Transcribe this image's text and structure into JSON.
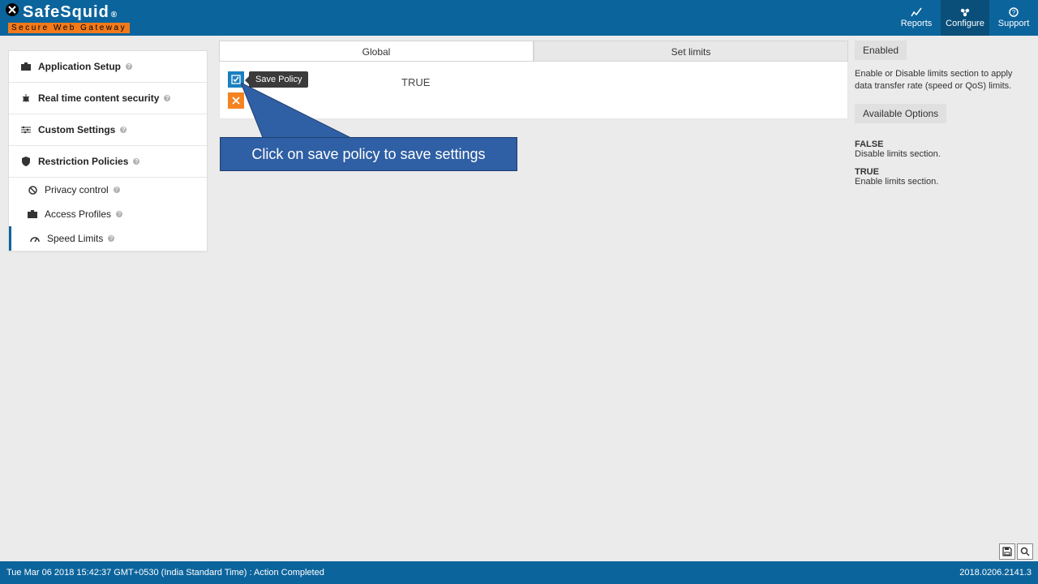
{
  "brand": {
    "name": "SafeSquid",
    "reg": "®",
    "tagline": "Secure Web Gateway"
  },
  "topnav": {
    "reports": "Reports",
    "configure": "Configure",
    "support": "Support"
  },
  "sidebar": {
    "items": [
      {
        "label": "Application Setup"
      },
      {
        "label": "Real time content security"
      },
      {
        "label": "Custom Settings"
      },
      {
        "label": "Restriction Policies"
      }
    ],
    "subitems": [
      {
        "label": "Privacy control"
      },
      {
        "label": "Access Profiles"
      },
      {
        "label": "Speed Limits"
      }
    ]
  },
  "tabs": {
    "global": "Global",
    "setlimits": "Set limits"
  },
  "content": {
    "save_tooltip": "Save Policy",
    "value": "TRUE"
  },
  "callout": {
    "text": "Click on save policy to save settings"
  },
  "rightpanel": {
    "label": "Enabled",
    "desc": "Enable or Disable limits section to apply data transfer rate (speed or QoS) limits.",
    "available": "Available Options",
    "options": [
      {
        "title": "FALSE",
        "desc": "Disable limits section."
      },
      {
        "title": "TRUE",
        "desc": "Enable limits section."
      }
    ]
  },
  "footer": {
    "status": "Tue Mar 06 2018 15:42:37 GMT+0530 (India Standard Time) : Action Completed",
    "version": "2018.0206.2141.3"
  }
}
